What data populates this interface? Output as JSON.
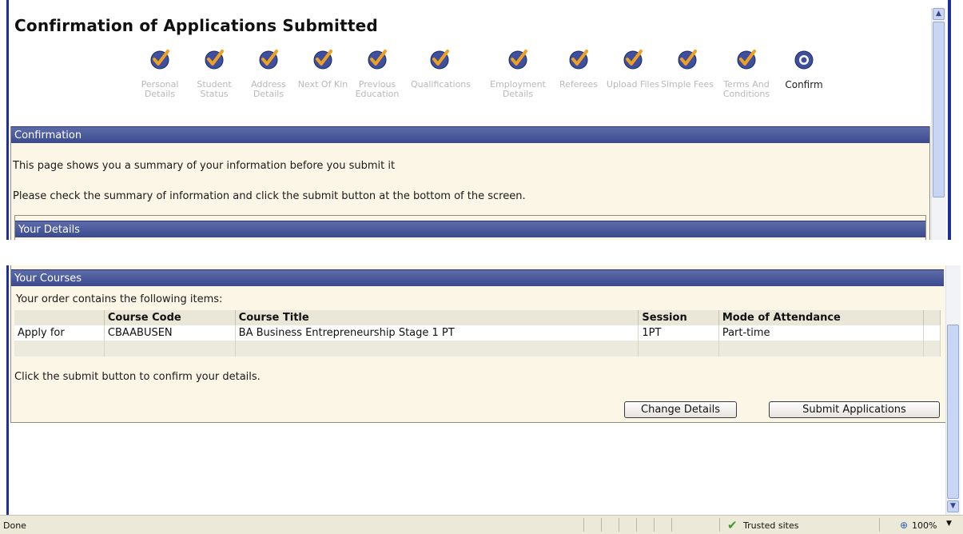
{
  "page": {
    "title": "Confirmation of Applications Submitted"
  },
  "steps": [
    {
      "label": "Personal Details",
      "state": "done"
    },
    {
      "label": "Student Status",
      "state": "done"
    },
    {
      "label": "Address Details",
      "state": "done"
    },
    {
      "label": "Next Of Kin",
      "state": "done"
    },
    {
      "label": "Previous Education",
      "state": "done"
    },
    {
      "label": "Qualifications",
      "state": "done"
    },
    {
      "label": "Employment Details",
      "state": "done"
    },
    {
      "label": "Referees",
      "state": "done"
    },
    {
      "label": "Upload Files",
      "state": "done"
    },
    {
      "label": "Simple Fees",
      "state": "done"
    },
    {
      "label": "Terms And Conditions",
      "state": "done"
    },
    {
      "label": "Confirm",
      "state": "current"
    }
  ],
  "confirmation": {
    "header": "Confirmation",
    "line1": "This page shows you a summary of your information before you submit it",
    "line2": "Please check the summary of information and click the submit button at the bottom of the screen."
  },
  "details": {
    "header": "Your Details"
  },
  "courses": {
    "header": "Your Courses",
    "intro": "Your order contains the following items:",
    "columns": [
      "",
      "Course Code",
      "Course Title",
      "Session",
      "Mode of Attendance"
    ],
    "rows": [
      [
        "Apply for",
        "CBAABUSEN",
        "BA Business Entrepreneurship Stage 1 PT",
        "1PT",
        "Part-time"
      ]
    ],
    "submit_hint": "Click the submit button to confirm your details."
  },
  "buttons": {
    "change": "Change Details",
    "submit": "Submit Applications"
  },
  "statusbar": {
    "status": "Done",
    "zone": "Trusted sites",
    "zoom": "100%"
  },
  "colors": {
    "accent_header": "#3a4a8e",
    "panel_bg": "#fbf6e6",
    "check_orange": "#f0a020",
    "check_circle": "#3d4f9e"
  }
}
